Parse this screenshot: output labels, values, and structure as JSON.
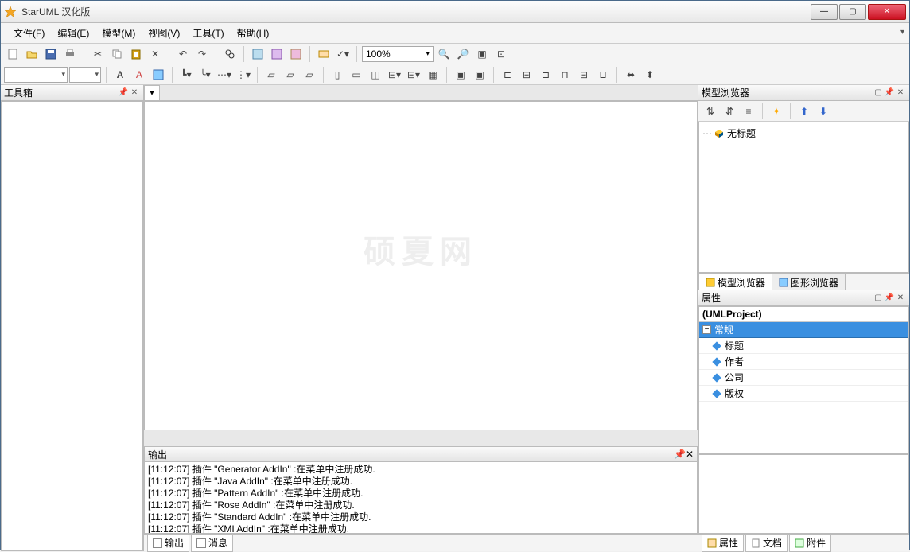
{
  "window": {
    "title": "StarUML 汉化版"
  },
  "menu": {
    "file": "文件(F)",
    "edit": "编辑(E)",
    "model": "模型(M)",
    "view": "视图(V)",
    "tools": "工具(T)",
    "help": "帮助(H)"
  },
  "toolbar": {
    "zoom": "100%"
  },
  "toolbox": {
    "title": "工具箱"
  },
  "output": {
    "title": "输出",
    "lines": [
      {
        "time": "[11:12:07]",
        "text": "插件  \"Generator AddIn\" :在菜单中注册成功."
      },
      {
        "time": "[11:12:07]",
        "text": "插件  \"Java AddIn\" :在菜单中注册成功."
      },
      {
        "time": "[11:12:07]",
        "text": "插件  \"Pattern AddIn\" :在菜单中注册成功."
      },
      {
        "time": "[11:12:07]",
        "text": "插件  \"Rose AddIn\" :在菜单中注册成功."
      },
      {
        "time": "[11:12:07]",
        "text": "插件  \"Standard AddIn\" :在菜单中注册成功."
      },
      {
        "time": "[11:12:07]",
        "text": "插件  \"XMI AddIn\" :在菜单中注册成功."
      }
    ]
  },
  "browser": {
    "title": "模型浏览器",
    "root": "无标题"
  },
  "browser_tabs": {
    "model": "模型浏览器",
    "diagram": "图形浏览器"
  },
  "props": {
    "title": "属性",
    "type": "(UMLProject)",
    "category": "常规",
    "items": [
      "标题",
      "作者",
      "公司",
      "版权"
    ]
  },
  "prop_tabs": {
    "props": "属性",
    "docs": "文档",
    "attach": "附件"
  },
  "bottom_tabs": {
    "output": "输出",
    "messages": "消息"
  },
  "watermark": "硕夏网"
}
